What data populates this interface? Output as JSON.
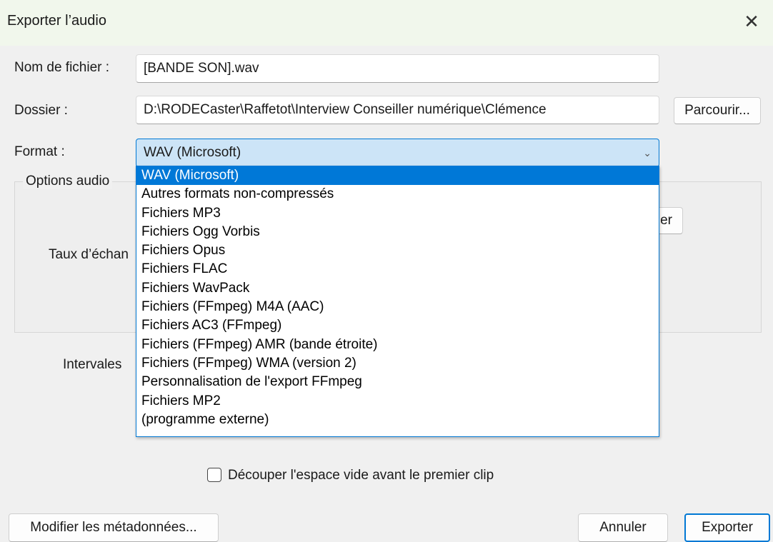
{
  "window": {
    "title": "Exporter l’audio",
    "close_glyph": "✕"
  },
  "filename": {
    "label": "Nom de fichier :",
    "value": "[BANDE SON].wav"
  },
  "folder": {
    "label": "Dossier :",
    "value": "D:\\RODECaster\\Raffetot\\Interview Conseiller numérique\\Clémence",
    "browse_label": "Parcourir..."
  },
  "format": {
    "label": "Format :",
    "selected": "WAV (Microsoft)",
    "options": [
      "WAV (Microsoft)",
      "Autres formats non-compressés",
      "Fichiers MP3",
      "Fichiers Ogg Vorbis",
      "Fichiers Opus",
      "Fichiers FLAC",
      "Fichiers WavPack",
      "Fichiers (FFmpeg) M4A (AAC)",
      "Fichiers AC3 (FFmpeg)",
      "Fichiers (FFmpeg) AMR (bande étroite)",
      "Fichiers (FFmpeg) WMA (version 2)",
      "Personnalisation de l'export FFmpeg",
      "Fichiers MP2",
      "(programme externe)"
    ]
  },
  "audio_options": {
    "title": "Options audio",
    "sample_rate_label_partial": "Taux d’échan",
    "hidden_button_partial": "er"
  },
  "intervals_label_partial": "Intervales",
  "trim_checkbox": {
    "label": "Découper l'espace vide avant le premier clip",
    "checked": false
  },
  "footer": {
    "metadata_label": "Modifier les métadonnées...",
    "cancel_label": "Annuler",
    "export_label": "Exporter"
  },
  "colors": {
    "accent": "#0078d4",
    "selection": "#0078d7",
    "title_bar": "#f1f7ec"
  }
}
